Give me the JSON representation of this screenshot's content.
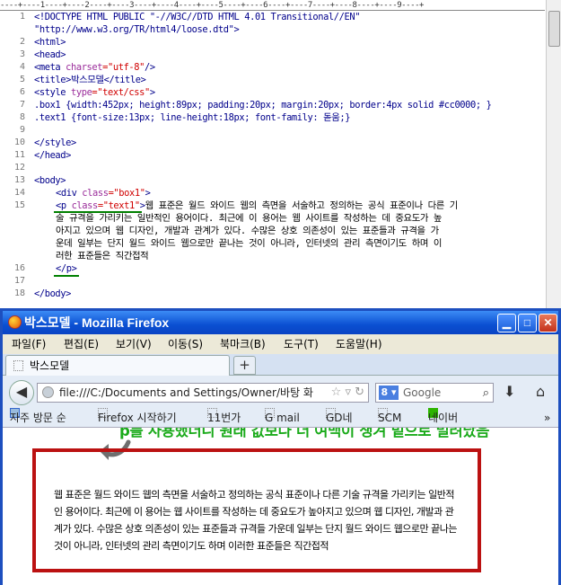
{
  "editor": {
    "ruler": "----+----1----+----2----+----3----+----4----+----5----+----6----+----7----+----8----+----9----+",
    "line_numbers": [
      "1",
      "2",
      "3",
      "4",
      "5",
      "6",
      "7",
      "8",
      "9",
      "10",
      "11",
      "12",
      "13",
      "14",
      "15",
      "16",
      "17",
      "18"
    ],
    "lines": {
      "l1": "<!DOCTYPE HTML PUBLIC \"-//W3C//DTD HTML 4.01 Transitional//EN\"",
      "l1b": "\"http://www.w3.org/TR/html4/loose.dtd\">",
      "l2": "<html>",
      "l3": "<head>",
      "l4_tag": "<meta",
      "l4_attr": " charset",
      "l4_val": "=\"utf-8\"",
      "l4_end": "/>",
      "l5": "<title>박스모델</title>",
      "l6_tag": "<style",
      "l6_attr": " type",
      "l6_val": "=\"text/css\"",
      "l6_end": ">",
      "l7": ".box1 {width:452px; height:89px; padding:20px; margin:20px; border:4px solid #cc0000; }",
      "l8": ".text1 {font-size:13px; line-height:18px; font-family: 돋움;}",
      "l10": "</style>",
      "l11": "</head>",
      "l13": "<body>",
      "l14_tag": "<div",
      "l14_attr": " class",
      "l14_val": "=\"box1\"",
      "l14_end": ">",
      "l15_tag": "<p",
      "l15_attr": " class",
      "l15_val": "=\"text1\"",
      "l15_end": ">",
      "l15_text": "웹 표준은 월드 와이드 웹의 측면을 서술하고 정의하는 공식 표준이나 다른 기",
      "l15_w2": "술 규격을 가리키는 일반적인 용어이다. 최근에 이 용어는 웹 사이트를 작성하는 데 중요도가 높",
      "l15_w3": "아지고 있으며 웹 디자인, 개발과 관계가 있다. 수많은 상호 의존성이 있는 표준들과 규격을 가",
      "l15_w4": "운데 일부는 단지 월드 와이드 웹으로만 끝나는 것이 아니라, 인터넷의 관리 측면이기도 하며 이",
      "l15_w5": "러한 표준들은 직간접적",
      "l16": "</p>",
      "l18": "</body>"
    }
  },
  "firefox": {
    "title": "박스모델 - Mozilla Firefox",
    "menu": [
      "파일(F)",
      "편집(E)",
      "보기(V)",
      "이동(S)",
      "북마크(B)",
      "도구(T)",
      "도움말(H)"
    ],
    "tab_label": "박스모델",
    "new_tab": "+",
    "url": "file:///C:/Documents and Settings/Owner/바탕 화",
    "search_engine": "8 ▾",
    "search_placeholder": "Google",
    "bookmarks": [
      "자주 방문 순",
      "Firefox 시작하기",
      "11번가",
      "G mail",
      "GD네",
      "SCM",
      "네이버"
    ],
    "bookmarks_overflow": "»",
    "content_note": "p를 사용했더니 원래 값보다 더 여백이 생겨 밑으로 밀려났음",
    "paragraph": "웹 표준은 월드 와이드 웹의 측면을 서술하고 정의하는 공식 표준이나 다른 기술 규격을 가리키는 일반적인 용어이다. 최근에 이 용어는 웹 사이트를 작성하는 데 중요도가 높아지고 있으며 웹 디자인, 개발과 관계가 있다. 수많은 상호 의존성이 있는 표준들과 규격들 가운데 일부는 단지 월드 와이드 웹으로만 끝나는 것이 아니라, 인터넷의 관리 측면이기도 하며 이러한 표준들은 직간접적"
  },
  "colors": {
    "box_border": "#bb1111",
    "note": "#1aaa1a",
    "titlebar": "#0a4fd2"
  }
}
